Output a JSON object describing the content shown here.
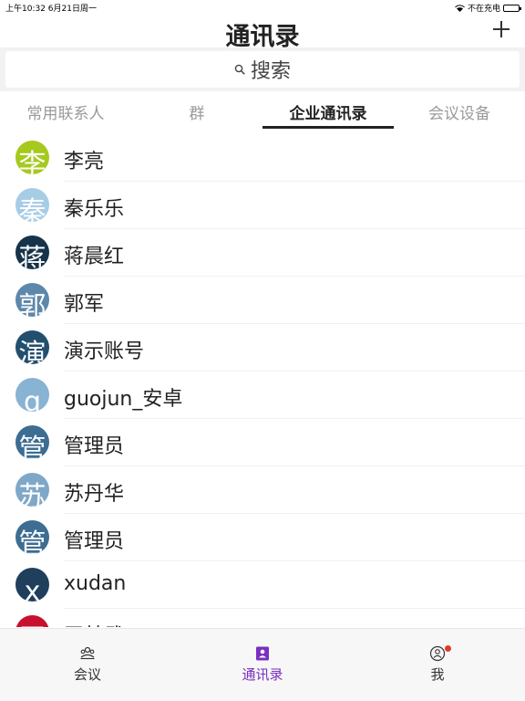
{
  "status_bar": {
    "time": "上午10:32  6月21日周一",
    "charging": "不在充电"
  },
  "header": {
    "title": "通讯录"
  },
  "search": {
    "placeholder": "搜索"
  },
  "tabs": [
    {
      "label": "常用联系人"
    },
    {
      "label": "群"
    },
    {
      "label": "企业通讯录"
    },
    {
      "label": "会议设备"
    }
  ],
  "contacts": [
    {
      "name": "李亮",
      "avatar_char": "李",
      "color": "#a6c91d"
    },
    {
      "name": "秦乐乐",
      "avatar_char": "秦",
      "color": "#a7cce6"
    },
    {
      "name": "蒋晨红",
      "avatar_char": "蒋",
      "color": "#163349"
    },
    {
      "name": "郭军",
      "avatar_char": "郭",
      "color": "#5d88ab"
    },
    {
      "name": "演示账号",
      "avatar_char": "演",
      "color": "#234f6f"
    },
    {
      "name": "guojun_安卓",
      "avatar_char": "g",
      "color": "#88b3d3"
    },
    {
      "name": "管理员",
      "avatar_char": "管",
      "color": "#3d6d92"
    },
    {
      "name": "苏丹华",
      "avatar_char": "苏",
      "color": "#7fa8c8"
    },
    {
      "name": "管理员",
      "avatar_char": "管",
      "color": "#3d6d92"
    },
    {
      "name": "xudan",
      "avatar_char": "x",
      "color": "#1f3f5c"
    },
    {
      "name": "王林武",
      "avatar_char": "王",
      "color": "#c8102e"
    }
  ],
  "tab_bar": {
    "meeting": "会议",
    "contacts": "通讯录",
    "me": "我",
    "accent_color": "#7a2fc0"
  }
}
